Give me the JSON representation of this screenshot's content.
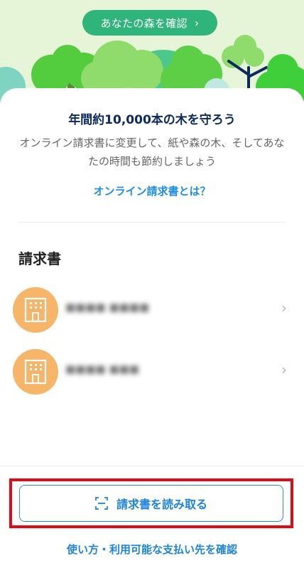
{
  "hero": {
    "forest_button_label": "あなたの森を確認",
    "chevron_glyph": "›"
  },
  "info": {
    "headline": "年間約10,000本の木を守ろう",
    "description": "オンライン請求書に変更して、紙や森の木、そしてあなたの時間も節約しましょう",
    "about_link": "オンライン請求書とは？"
  },
  "invoices": {
    "title": "請求書",
    "items": [
      {
        "name": "■■■■ ■■■■",
        "icon": "building-icon"
      },
      {
        "name": "■■■■ ■■■",
        "icon": "building-icon"
      }
    ],
    "chevron_glyph": "›"
  },
  "footer": {
    "scan_button_label": "請求書を読み取る",
    "scan_icon": "scan-icon",
    "help_link": "使い方・利用可能な支払い先を確認"
  },
  "colors": {
    "accent_green": "#2fb57c",
    "brand_navy": "#0c2a5b",
    "link_blue": "#1f83d8",
    "avatar_orange": "#f7b56a",
    "highlight_red": "#e20a16"
  }
}
